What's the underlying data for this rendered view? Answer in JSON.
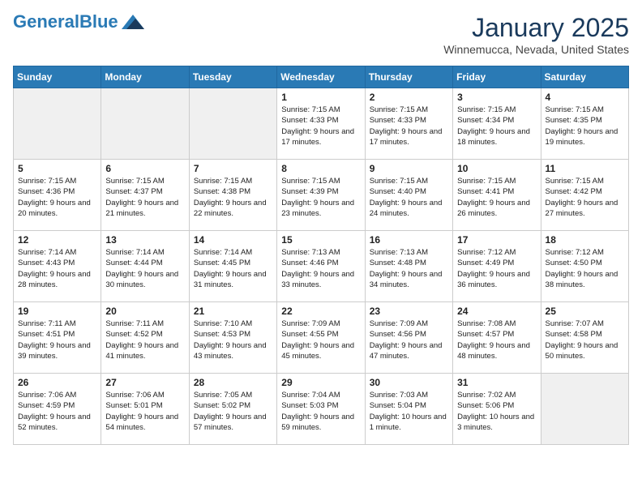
{
  "header": {
    "logo_general": "General",
    "logo_blue": "Blue",
    "month_title": "January 2025",
    "location": "Winnemucca, Nevada, United States"
  },
  "days_of_week": [
    "Sunday",
    "Monday",
    "Tuesday",
    "Wednesday",
    "Thursday",
    "Friday",
    "Saturday"
  ],
  "weeks": [
    [
      {
        "day": "",
        "empty": true
      },
      {
        "day": "",
        "empty": true
      },
      {
        "day": "",
        "empty": true
      },
      {
        "day": "1",
        "sunrise": "7:15 AM",
        "sunset": "4:33 PM",
        "daylight": "9 hours and 17 minutes."
      },
      {
        "day": "2",
        "sunrise": "7:15 AM",
        "sunset": "4:33 PM",
        "daylight": "9 hours and 17 minutes."
      },
      {
        "day": "3",
        "sunrise": "7:15 AM",
        "sunset": "4:34 PM",
        "daylight": "9 hours and 18 minutes."
      },
      {
        "day": "4",
        "sunrise": "7:15 AM",
        "sunset": "4:35 PM",
        "daylight": "9 hours and 19 minutes."
      }
    ],
    [
      {
        "day": "5",
        "sunrise": "7:15 AM",
        "sunset": "4:36 PM",
        "daylight": "9 hours and 20 minutes."
      },
      {
        "day": "6",
        "sunrise": "7:15 AM",
        "sunset": "4:37 PM",
        "daylight": "9 hours and 21 minutes."
      },
      {
        "day": "7",
        "sunrise": "7:15 AM",
        "sunset": "4:38 PM",
        "daylight": "9 hours and 22 minutes."
      },
      {
        "day": "8",
        "sunrise": "7:15 AM",
        "sunset": "4:39 PM",
        "daylight": "9 hours and 23 minutes."
      },
      {
        "day": "9",
        "sunrise": "7:15 AM",
        "sunset": "4:40 PM",
        "daylight": "9 hours and 24 minutes."
      },
      {
        "day": "10",
        "sunrise": "7:15 AM",
        "sunset": "4:41 PM",
        "daylight": "9 hours and 26 minutes."
      },
      {
        "day": "11",
        "sunrise": "7:15 AM",
        "sunset": "4:42 PM",
        "daylight": "9 hours and 27 minutes."
      }
    ],
    [
      {
        "day": "12",
        "sunrise": "7:14 AM",
        "sunset": "4:43 PM",
        "daylight": "9 hours and 28 minutes."
      },
      {
        "day": "13",
        "sunrise": "7:14 AM",
        "sunset": "4:44 PM",
        "daylight": "9 hours and 30 minutes."
      },
      {
        "day": "14",
        "sunrise": "7:14 AM",
        "sunset": "4:45 PM",
        "daylight": "9 hours and 31 minutes."
      },
      {
        "day": "15",
        "sunrise": "7:13 AM",
        "sunset": "4:46 PM",
        "daylight": "9 hours and 33 minutes."
      },
      {
        "day": "16",
        "sunrise": "7:13 AM",
        "sunset": "4:48 PM",
        "daylight": "9 hours and 34 minutes."
      },
      {
        "day": "17",
        "sunrise": "7:12 AM",
        "sunset": "4:49 PM",
        "daylight": "9 hours and 36 minutes."
      },
      {
        "day": "18",
        "sunrise": "7:12 AM",
        "sunset": "4:50 PM",
        "daylight": "9 hours and 38 minutes."
      }
    ],
    [
      {
        "day": "19",
        "sunrise": "7:11 AM",
        "sunset": "4:51 PM",
        "daylight": "9 hours and 39 minutes."
      },
      {
        "day": "20",
        "sunrise": "7:11 AM",
        "sunset": "4:52 PM",
        "daylight": "9 hours and 41 minutes."
      },
      {
        "day": "21",
        "sunrise": "7:10 AM",
        "sunset": "4:53 PM",
        "daylight": "9 hours and 43 minutes."
      },
      {
        "day": "22",
        "sunrise": "7:09 AM",
        "sunset": "4:55 PM",
        "daylight": "9 hours and 45 minutes."
      },
      {
        "day": "23",
        "sunrise": "7:09 AM",
        "sunset": "4:56 PM",
        "daylight": "9 hours and 47 minutes."
      },
      {
        "day": "24",
        "sunrise": "7:08 AM",
        "sunset": "4:57 PM",
        "daylight": "9 hours and 48 minutes."
      },
      {
        "day": "25",
        "sunrise": "7:07 AM",
        "sunset": "4:58 PM",
        "daylight": "9 hours and 50 minutes."
      }
    ],
    [
      {
        "day": "26",
        "sunrise": "7:06 AM",
        "sunset": "4:59 PM",
        "daylight": "9 hours and 52 minutes."
      },
      {
        "day": "27",
        "sunrise": "7:06 AM",
        "sunset": "5:01 PM",
        "daylight": "9 hours and 54 minutes."
      },
      {
        "day": "28",
        "sunrise": "7:05 AM",
        "sunset": "5:02 PM",
        "daylight": "9 hours and 57 minutes."
      },
      {
        "day": "29",
        "sunrise": "7:04 AM",
        "sunset": "5:03 PM",
        "daylight": "9 hours and 59 minutes."
      },
      {
        "day": "30",
        "sunrise": "7:03 AM",
        "sunset": "5:04 PM",
        "daylight": "10 hours and 1 minute."
      },
      {
        "day": "31",
        "sunrise": "7:02 AM",
        "sunset": "5:06 PM",
        "daylight": "10 hours and 3 minutes."
      },
      {
        "day": "",
        "empty": true
      }
    ]
  ]
}
